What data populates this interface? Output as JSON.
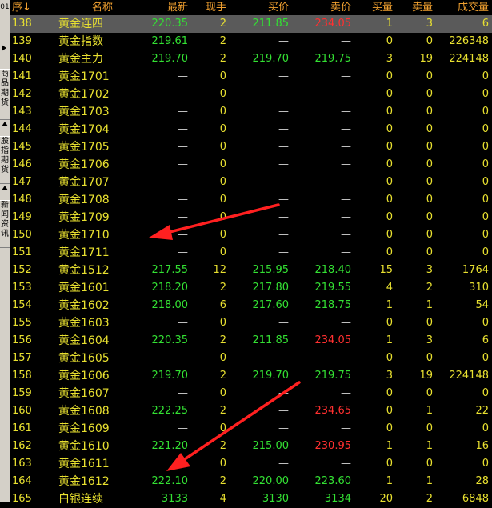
{
  "sidebar": {
    "page_num": "01",
    "tabs": [
      "商品期货",
      "股指期货",
      "新闻资讯"
    ]
  },
  "header": {
    "seq": "序↓",
    "name": "名称",
    "last": "最新",
    "now": "现手",
    "bid": "买价",
    "ask": "卖价",
    "bid_qty": "买量",
    "ask_qty": "卖量",
    "volume": "成交量"
  },
  "rows": [
    {
      "seq": "138",
      "name": "黄金连四",
      "last": "220.35",
      "now": "2",
      "bid": "211.85",
      "ask": "234.05",
      "bq": "1",
      "aq": "3",
      "vol": "6",
      "ask_red": true,
      "selected": true
    },
    {
      "seq": "139",
      "name": "黄金指数",
      "last": "219.61",
      "now": "2",
      "bid": "—",
      "ask": "—",
      "bq": "0",
      "aq": "0",
      "vol": "226348"
    },
    {
      "seq": "140",
      "name": "黄金主力",
      "last": "219.70",
      "now": "2",
      "bid": "219.70",
      "ask": "219.75",
      "bq": "3",
      "aq": "19",
      "vol": "224148"
    },
    {
      "seq": "141",
      "name": "黄金1701",
      "last": "—",
      "now": "0",
      "bid": "—",
      "ask": "—",
      "bq": "0",
      "aq": "0",
      "vol": "0"
    },
    {
      "seq": "142",
      "name": "黄金1702",
      "last": "—",
      "now": "0",
      "bid": "—",
      "ask": "—",
      "bq": "0",
      "aq": "0",
      "vol": "0"
    },
    {
      "seq": "143",
      "name": "黄金1703",
      "last": "—",
      "now": "0",
      "bid": "—",
      "ask": "—",
      "bq": "0",
      "aq": "0",
      "vol": "0"
    },
    {
      "seq": "144",
      "name": "黄金1704",
      "last": "—",
      "now": "0",
      "bid": "—",
      "ask": "—",
      "bq": "0",
      "aq": "0",
      "vol": "0"
    },
    {
      "seq": "145",
      "name": "黄金1705",
      "last": "—",
      "now": "0",
      "bid": "—",
      "ask": "—",
      "bq": "0",
      "aq": "0",
      "vol": "0"
    },
    {
      "seq": "146",
      "name": "黄金1706",
      "last": "—",
      "now": "0",
      "bid": "—",
      "ask": "—",
      "bq": "0",
      "aq": "0",
      "vol": "0"
    },
    {
      "seq": "147",
      "name": "黄金1707",
      "last": "—",
      "now": "0",
      "bid": "—",
      "ask": "—",
      "bq": "0",
      "aq": "0",
      "vol": "0"
    },
    {
      "seq": "148",
      "name": "黄金1708",
      "last": "—",
      "now": "0",
      "bid": "—",
      "ask": "—",
      "bq": "0",
      "aq": "0",
      "vol": "0"
    },
    {
      "seq": "149",
      "name": "黄金1709",
      "last": "—",
      "now": "0",
      "bid": "—",
      "ask": "—",
      "bq": "0",
      "aq": "0",
      "vol": "0"
    },
    {
      "seq": "150",
      "name": "黄金1710",
      "last": "—",
      "now": "0",
      "bid": "—",
      "ask": "—",
      "bq": "0",
      "aq": "0",
      "vol": "0"
    },
    {
      "seq": "151",
      "name": "黄金1711",
      "last": "—",
      "now": "0",
      "bid": "—",
      "ask": "—",
      "bq": "0",
      "aq": "0",
      "vol": "0"
    },
    {
      "seq": "152",
      "name": "黄金1512",
      "last": "217.55",
      "now": "12",
      "bid": "215.95",
      "ask": "218.40",
      "bq": "15",
      "aq": "3",
      "vol": "1764"
    },
    {
      "seq": "153",
      "name": "黄金1601",
      "last": "218.20",
      "now": "2",
      "bid": "217.80",
      "ask": "219.55",
      "bq": "4",
      "aq": "2",
      "vol": "310"
    },
    {
      "seq": "154",
      "name": "黄金1602",
      "last": "218.00",
      "now": "6",
      "bid": "217.60",
      "ask": "218.75",
      "bq": "1",
      "aq": "1",
      "vol": "54"
    },
    {
      "seq": "155",
      "name": "黄金1603",
      "last": "—",
      "now": "0",
      "bid": "—",
      "ask": "—",
      "bq": "0",
      "aq": "0",
      "vol": "0"
    },
    {
      "seq": "156",
      "name": "黄金1604",
      "last": "220.35",
      "now": "2",
      "bid": "211.85",
      "ask": "234.05",
      "bq": "1",
      "aq": "3",
      "vol": "6",
      "ask_red": true
    },
    {
      "seq": "157",
      "name": "黄金1605",
      "last": "—",
      "now": "0",
      "bid": "—",
      "ask": "—",
      "bq": "0",
      "aq": "0",
      "vol": "0"
    },
    {
      "seq": "158",
      "name": "黄金1606",
      "last": "219.70",
      "now": "2",
      "bid": "219.70",
      "ask": "219.75",
      "bq": "3",
      "aq": "19",
      "vol": "224148"
    },
    {
      "seq": "159",
      "name": "黄金1607",
      "last": "—",
      "now": "0",
      "bid": "—",
      "ask": "—",
      "bq": "0",
      "aq": "0",
      "vol": "0"
    },
    {
      "seq": "160",
      "name": "黄金1608",
      "last": "222.25",
      "now": "2",
      "bid": "—",
      "ask": "234.65",
      "bq": "0",
      "aq": "1",
      "vol": "22",
      "ask_red": true
    },
    {
      "seq": "161",
      "name": "黄金1609",
      "last": "—",
      "now": "0",
      "bid": "—",
      "ask": "—",
      "bq": "0",
      "aq": "0",
      "vol": "0"
    },
    {
      "seq": "162",
      "name": "黄金1610",
      "last": "221.20",
      "now": "2",
      "bid": "215.00",
      "ask": "230.95",
      "bq": "1",
      "aq": "1",
      "vol": "16",
      "ask_red": true
    },
    {
      "seq": "163",
      "name": "黄金1611",
      "last": "—",
      "now": "0",
      "bid": "—",
      "ask": "—",
      "bq": "0",
      "aq": "0",
      "vol": "0"
    },
    {
      "seq": "164",
      "name": "黄金1612",
      "last": "222.10",
      "now": "2",
      "bid": "220.00",
      "ask": "223.60",
      "bq": "1",
      "aq": "1",
      "vol": "28"
    },
    {
      "seq": "165",
      "name": "白银连续",
      "last": "3133",
      "now": "4",
      "bid": "3130",
      "ask": "3134",
      "bq": "20",
      "aq": "2",
      "vol": "6848"
    }
  ],
  "colors": {
    "background": "#000000",
    "header_text": "#f0a030",
    "name_text": "#e8e030",
    "price_up": "#33e033",
    "price_down": "#ff3030",
    "selected_row": "#5a5a5a",
    "annotation_arrow": "#ff2020"
  }
}
